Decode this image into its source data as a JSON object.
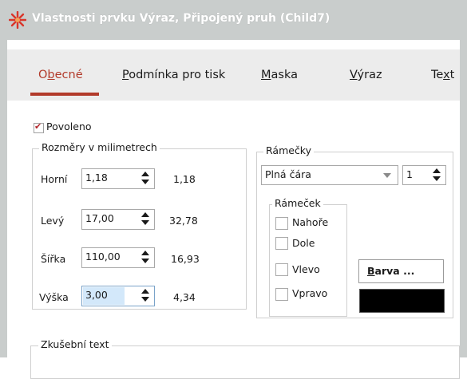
{
  "window": {
    "title": "Vlastnosti prvku Výraz, Připojený pruh (Child7)",
    "icon": "red-star-icon"
  },
  "tabs": [
    {
      "label": "Obecné",
      "active": true
    },
    {
      "label": "Podmínka pro tisk",
      "active": false
    },
    {
      "label": "Maska",
      "active": false
    },
    {
      "label": "Výraz",
      "active": false
    },
    {
      "label": "Text",
      "active": false
    }
  ],
  "enabled": {
    "label": "Povoleno",
    "checked": true
  },
  "dimensions": {
    "title": "Rozměry v milimetrech",
    "rows": [
      {
        "label": "Horní",
        "value": "1,18",
        "computed": "1,18"
      },
      {
        "label": "Levý",
        "value": "17,00",
        "computed": "32,78"
      },
      {
        "label": "Šířka",
        "value": "110,00",
        "computed": "16,93"
      },
      {
        "label": "Výška",
        "value": "3,00",
        "computed": "4,34"
      }
    ]
  },
  "borders": {
    "title": "Rámečky",
    "line_style": "Plná čára",
    "line_width": "1",
    "frame": {
      "title": "Rámeček",
      "options": [
        {
          "label": "Nahoře",
          "checked": false
        },
        {
          "label": "Dole",
          "checked": false
        },
        {
          "label": "Vlevo",
          "checked": false
        },
        {
          "label": "Vpravo",
          "checked": false
        }
      ]
    },
    "color_button": "Barva ...",
    "color": "#000000"
  },
  "sample_text": {
    "title": "Zkušební text"
  },
  "colors": {
    "accent": "#b23a2a",
    "tab_bar": "#ececec",
    "title_bar": "#c9cdcc"
  }
}
